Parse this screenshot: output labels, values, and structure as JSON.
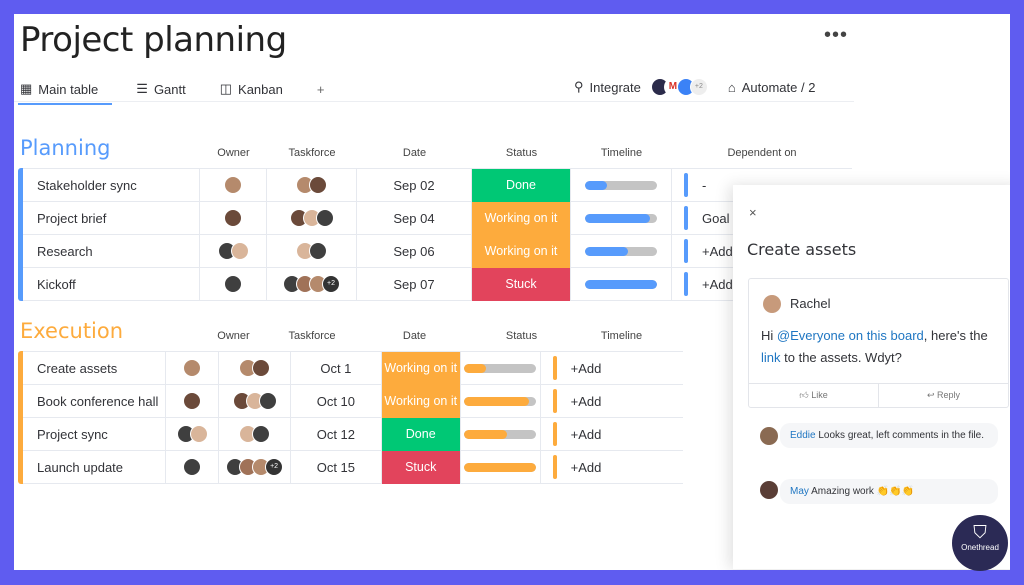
{
  "header": {
    "title": "Project planning",
    "more": "•••"
  },
  "tabs": [
    {
      "label": "Main table",
      "icon": "table-icon"
    },
    {
      "label": "Gantt",
      "icon": "gantt-icon"
    },
    {
      "label": "Kanban",
      "icon": "kanban-icon"
    },
    {
      "label": "+",
      "icon": "plus-icon"
    }
  ],
  "toolbar": {
    "integrate": "Integrate",
    "integrations_more": "+2",
    "automate": "Automate / 2"
  },
  "colors": {
    "planning": "#579bfc",
    "execution": "#fdab3d",
    "done": "#00c875",
    "working": "#fdab3d",
    "stuck": "#e2445c",
    "frame": "#5f5cf0"
  },
  "groups": [
    {
      "title": "Planning",
      "color": "#579bfc",
      "columns": [
        "Owner",
        "Taskforce",
        "Date",
        "Status",
        "Timeline",
        "Dependent on"
      ],
      "rows": [
        {
          "name": "Stakeholder sync",
          "date": "Sep 02",
          "status": "Done",
          "timeline": 0.3,
          "dep": "-",
          "task_more": ""
        },
        {
          "name": "Project brief",
          "date": "Sep 04",
          "status": "Working on it",
          "timeline": 0.9,
          "dep": "Goal",
          "task_more": ""
        },
        {
          "name": "Research",
          "date": "Sep 06",
          "status": "Working on it",
          "timeline": 0.6,
          "dep": "+Add",
          "task_more": ""
        },
        {
          "name": "Kickoff",
          "date": "Sep 07",
          "status": "Stuck",
          "timeline": 1.0,
          "dep": "+Add",
          "task_more": "+2"
        }
      ]
    },
    {
      "title": "Execution",
      "color": "#fdab3d",
      "columns": [
        "Owner",
        "Taskforce",
        "Date",
        "Status",
        "Timeline"
      ],
      "rows": [
        {
          "name": "Create assets",
          "date": "Oct 1",
          "status": "Working on it",
          "timeline": 0.3,
          "dep": "+Add",
          "task_more": ""
        },
        {
          "name": "Book conference hall",
          "date": "Oct 10",
          "status": "Working on it",
          "timeline": 0.9,
          "dep": "+Add",
          "task_more": ""
        },
        {
          "name": "Project sync",
          "date": "Oct 12",
          "status": "Done",
          "timeline": 0.6,
          "dep": "+Add",
          "task_more": ""
        },
        {
          "name": "Launch update",
          "date": "Oct 15",
          "status": "Stuck",
          "timeline": 1.0,
          "dep": "+Add",
          "task_more": "+2"
        }
      ]
    }
  ],
  "panel": {
    "close": "×",
    "title": "Create assets",
    "comment": {
      "author": "Rachel",
      "pre": "Hi ",
      "mention": "@Everyone on this board",
      "mid": ", here's the ",
      "link": "link",
      "post": " to the assets. Wdyt?"
    },
    "like": "Like",
    "reply": "Reply",
    "replies": [
      {
        "author": "Eddie",
        "text": " Looks great, left comments in the file."
      },
      {
        "author": "May",
        "text": " Amazing work 👏👏👏"
      }
    ]
  },
  "watermark": {
    "text": "Onethread"
  }
}
